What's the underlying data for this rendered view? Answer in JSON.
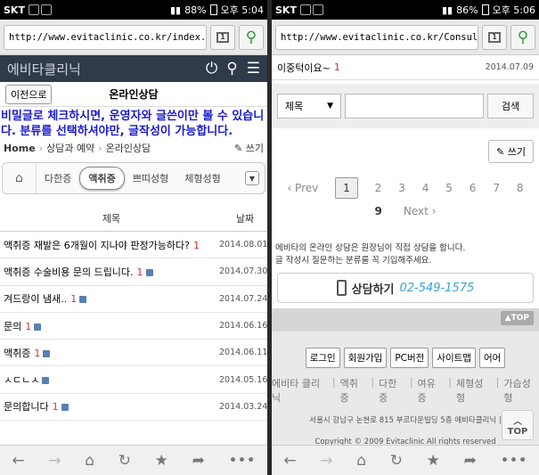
{
  "left": {
    "status": {
      "carrier": "SKT",
      "battery": "88%",
      "time": "오후 5:04"
    },
    "browser": {
      "url": "http://www.evitaclinic.co.kr/index.p…",
      "tab_count": "1"
    },
    "site": {
      "name": "에비타클리닉"
    },
    "subbar": {
      "back_label": "이전으로",
      "title": "온라인상담"
    },
    "notice": "비밀글로 체크하시면, 운영자와 글쓴이만 볼 수 있습니다. 분류를 선택하셔야만, 글작성이 가능합니다.",
    "breadcrumb": {
      "home": "Home",
      "level1": "상담과 예약",
      "level2": "온라인상담"
    },
    "write_label": "쓰기",
    "categories": [
      "다한증",
      "액취증",
      "쁘띠성형",
      "체형성형"
    ],
    "list_header": {
      "title": "제목",
      "date": "날짜"
    },
    "rows": [
      {
        "title": "액취증 재발은 6개월이 지나야 판정가능하다?",
        "count": "1",
        "locked": false,
        "date": "2014.08.01"
      },
      {
        "title": "액취증 수술비용 문의 드립니다.",
        "count": "1",
        "locked": true,
        "date": "2014.07.30"
      },
      {
        "title": "겨드랑이 냄새..",
        "count": "1",
        "locked": true,
        "date": "2014.07.24"
      },
      {
        "title": "문의",
        "count": "1",
        "locked": true,
        "date": "2014.06.16"
      },
      {
        "title": "액취증",
        "count": "1",
        "locked": true,
        "date": "2014.06.11"
      },
      {
        "title": "ㅅㄷㄴㅅ",
        "count": "",
        "locked": true,
        "date": "2014.05.16"
      },
      {
        "title": "문의합니다",
        "count": "1",
        "locked": true,
        "date": "2014.03.24"
      }
    ]
  },
  "right": {
    "status": {
      "carrier": "SKT",
      "battery": "86%",
      "time": "오후 5:06"
    },
    "browser": {
      "url": "http://www.evitaclinic.co.kr/Consult",
      "tab_count": "1"
    },
    "top_row": {
      "title": "이중턱이요~",
      "count": "1",
      "date": "2014.07.09"
    },
    "search": {
      "select_value": "제목",
      "button": "검색"
    },
    "write_label": "쓰기",
    "pager": {
      "prev": "‹ Prev",
      "pages": [
        "1",
        "2",
        "3",
        "4",
        "5",
        "6",
        "7",
        "8"
      ],
      "last_page": "9",
      "next": "Next ›"
    },
    "intro": [
      "에비타의 온라인 상담은 원장님이 직접 상담을 합니다.",
      "글 작성시 질문하는 분류를 꼭 기입해주세요."
    ],
    "call": {
      "label": "상담하기",
      "number": "02-549-1575"
    },
    "top_label": "TOP",
    "footer_buttons": [
      "로그인",
      "회원가입",
      "PC버전",
      "사이트맵",
      "어어"
    ],
    "footer_links": [
      "에비타 클리닉",
      "액취증",
      "다한증",
      "여유증",
      "체형성형",
      "가슴성형"
    ],
    "address": "서울시 강남구 논현로 815 부르다운빌딩 5층 에비타클리닉 |",
    "copyright": "Copyright © 2009 Evitaclinic All rights reserved"
  }
}
